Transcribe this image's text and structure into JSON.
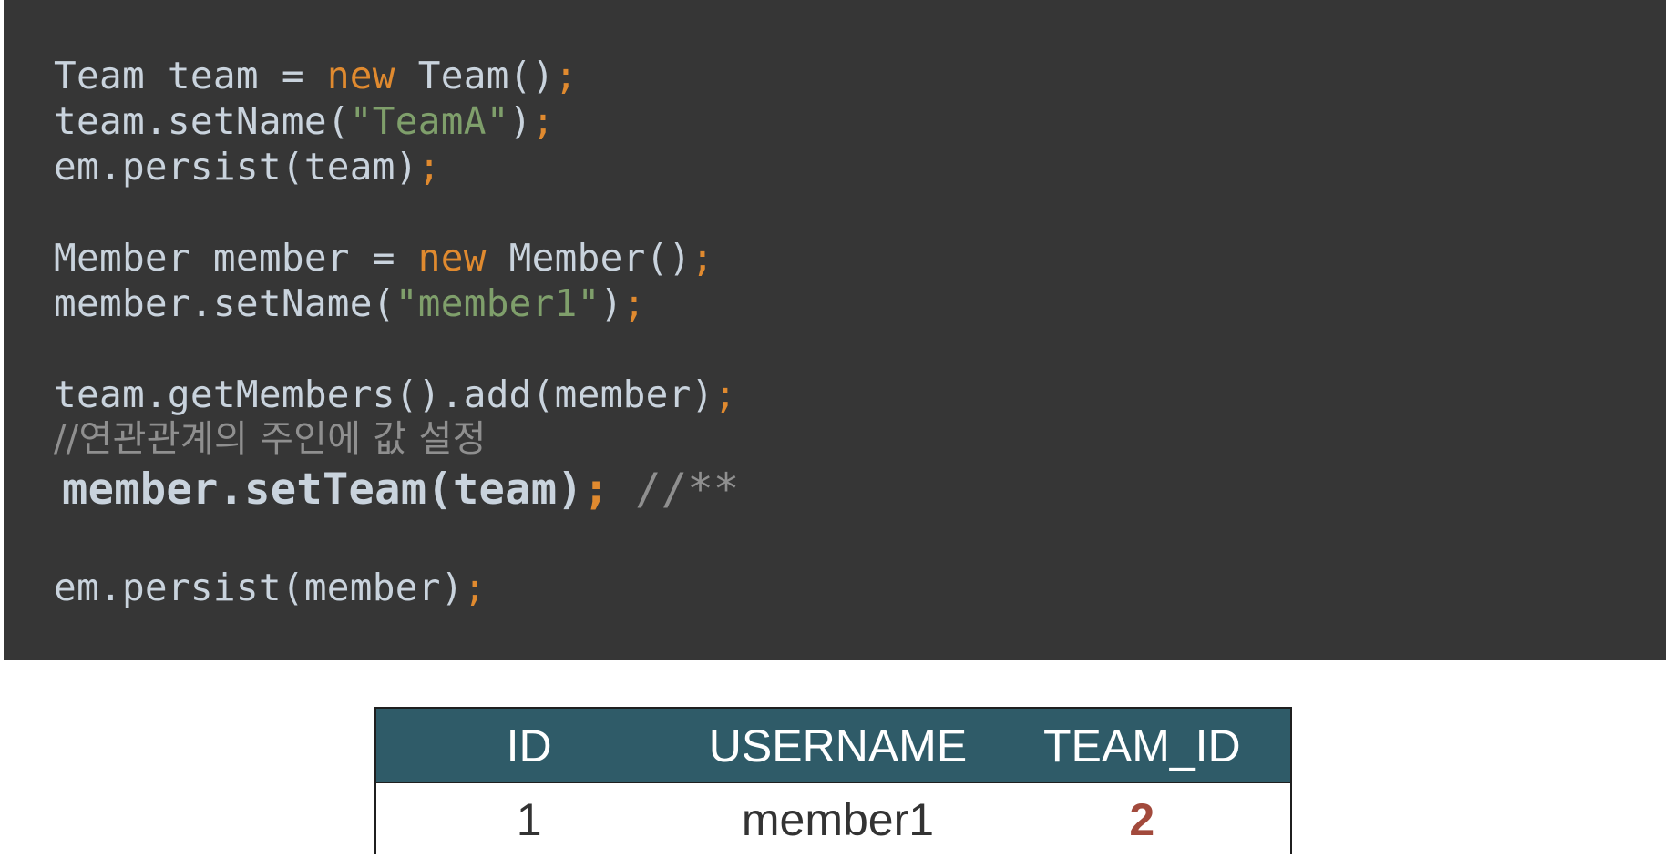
{
  "code": {
    "l1": {
      "a": "Team team = ",
      "kw": "new",
      "b": " Team()",
      "semi": ";"
    },
    "l2": {
      "a": "team.setName(",
      "str": "\"TeamA\"",
      "b": ")",
      "semi": ";"
    },
    "l3": {
      "a": "em.persist(team)",
      "semi": ";"
    },
    "l4": {
      "a": "Member member = ",
      "kw": "new",
      "b": " Member()",
      "semi": ";"
    },
    "l5": {
      "a": "member.setName(",
      "str": "\"member1\"",
      "b": ")",
      "semi": ";"
    },
    "l6": {
      "a": "team.getMembers().add(member)",
      "semi": ";"
    },
    "l7": {
      "comment": "//연관관계의 주인에 값 설정"
    },
    "l8": {
      "a": "member.setTeam(team)",
      "semi": ";",
      "comment": " //**"
    },
    "l9": {
      "a": "em.persist(member)",
      "semi": ";"
    }
  },
  "table": {
    "headers": [
      "ID",
      "USERNAME",
      "TEAM_ID"
    ],
    "rows": [
      [
        "1",
        "member1",
        "2"
      ]
    ]
  }
}
